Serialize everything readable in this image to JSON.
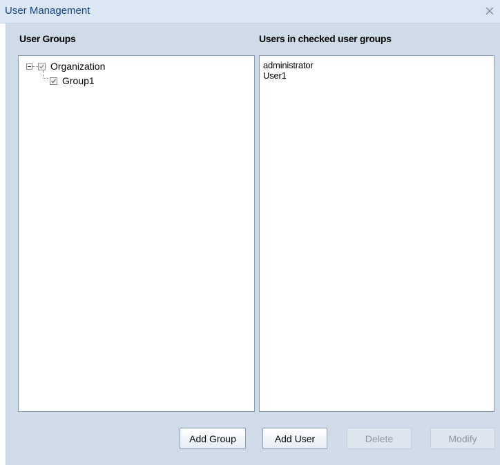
{
  "window": {
    "title": "User Management"
  },
  "groups_panel": {
    "label": "User Groups",
    "tree": [
      {
        "label": "Organization",
        "checked": true,
        "expanded": true
      },
      {
        "label": "Group1",
        "checked": true
      }
    ]
  },
  "users_panel": {
    "label": "Users in checked user groups",
    "users": [
      "administrator",
      "User1"
    ]
  },
  "buttons": {
    "add_group": "Add Group",
    "add_user": "Add User",
    "delete": "Delete",
    "modify": "Modify"
  }
}
